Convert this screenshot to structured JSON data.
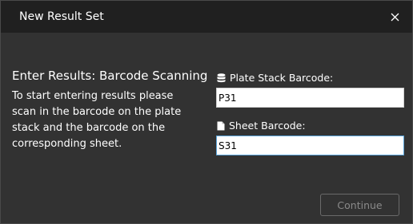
{
  "window": {
    "title": "New Result Set"
  },
  "main": {
    "heading": "Enter Results: Barcode Scanning",
    "instructions": "To start entering results please scan in the barcode on the plate stack and the barcode on the corresponding sheet."
  },
  "fields": {
    "plate_stack": {
      "label": "Plate Stack Barcode:",
      "value": "P31",
      "icon": "database-icon"
    },
    "sheet": {
      "label": "Sheet Barcode:",
      "value": "S31",
      "icon": "document-icon"
    }
  },
  "footer": {
    "continue_label": "Continue"
  }
}
